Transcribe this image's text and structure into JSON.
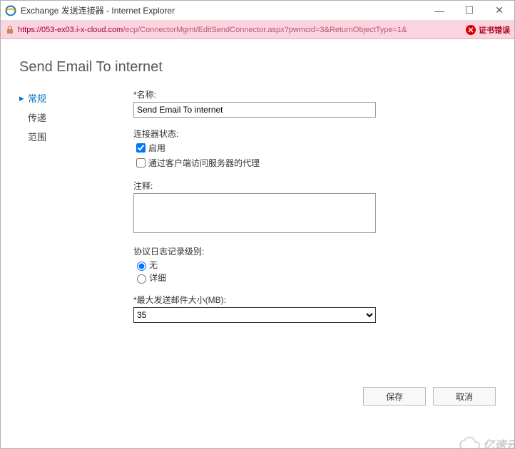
{
  "window": {
    "title": "Exchange 发送连接器 - Internet Explorer",
    "controls": {
      "min": "—",
      "max": "☐",
      "close": "✕"
    }
  },
  "addressbar": {
    "host": "https://053-ex03.i-x-cloud.com",
    "path": "/ecp/ConnectorMgmt/EditSendConnector.aspx?pwmcid=3&ReturnObjectType=1&",
    "cert_error": "证书错误"
  },
  "page": {
    "title": "Send Email To internet"
  },
  "nav": {
    "items": [
      {
        "label": "常规",
        "active": true
      },
      {
        "label": "传递",
        "active": false
      },
      {
        "label": "范围",
        "active": false
      }
    ]
  },
  "form": {
    "name_label": "*名称:",
    "name_value": "Send Email To internet",
    "status_label": "连接器状态:",
    "enable_label": "启用",
    "proxy_label": "通过客户端访问服务器的代理",
    "comment_label": "注释:",
    "comment_value": "",
    "loglevel_label": "协议日志记录级别:",
    "radio_none": "无",
    "radio_detail": "详细",
    "maxsize_label": "*最大发送邮件大小(MB):",
    "maxsize_value": "35",
    "maxsize_options": [
      "35"
    ]
  },
  "buttons": {
    "save": "保存",
    "cancel": "取消"
  },
  "watermark": {
    "text": "亿速云"
  }
}
